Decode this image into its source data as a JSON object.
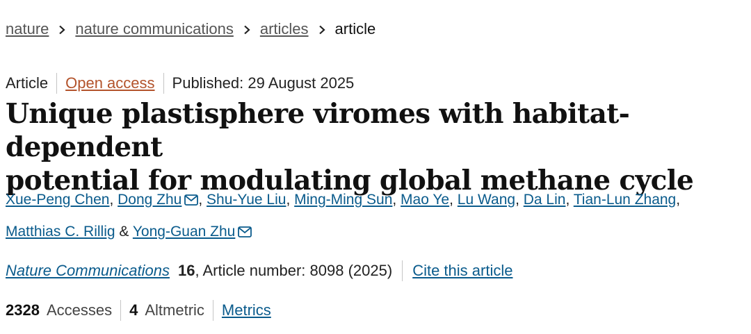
{
  "breadcrumb": {
    "items": [
      {
        "label": "nature",
        "link": true
      },
      {
        "label": "nature communications",
        "link": true
      },
      {
        "label": "articles",
        "link": true
      },
      {
        "label": "article",
        "link": false
      }
    ]
  },
  "article_meta": {
    "type": "Article",
    "access": "Open access",
    "published": "Published: 29 August 2025"
  },
  "title_lines": [
    "Unique plastisphere viromes with habitat-dependent",
    "potential for modulating global methane cycle"
  ],
  "authors": [
    {
      "name": "Xue-Peng Chen",
      "mail": false,
      "sep": ", "
    },
    {
      "name": "Dong Zhu",
      "mail": true,
      "sep": ", "
    },
    {
      "name": "Shu-Yue Liu",
      "mail": false,
      "sep": ", "
    },
    {
      "name": "Ming-Ming Sun",
      "mail": false,
      "sep": ", "
    },
    {
      "name": "Mao Ye",
      "mail": false,
      "sep": ", "
    },
    {
      "name": "Lu Wang",
      "mail": false,
      "sep": ", "
    },
    {
      "name": "Da Lin",
      "mail": false,
      "sep": ", "
    },
    {
      "name": "Tian-Lun Zhang",
      "mail": false,
      "sep": ","
    },
    {
      "name": "Matthias C. Rillig",
      "mail": false,
      "sep": " & "
    },
    {
      "name": "Yong-Guan Zhu",
      "mail": true,
      "sep": ""
    }
  ],
  "citation": {
    "journal": "Nature Communications",
    "volume": "16",
    "article_number": ", Article number: 8098 (2025)",
    "cite_label": "Cite this article"
  },
  "metrics": {
    "accesses_count": "2328",
    "accesses_label": "Accesses",
    "altmetric_count": "4",
    "altmetric_label": "Altmetric",
    "metrics_label": "Metrics"
  },
  "icons": {
    "breadcrumb_separator": "chevron-right-icon",
    "author_contact": "envelope-icon"
  },
  "colors": {
    "link": "#0a5b8c",
    "open_access": "#b3532b",
    "title": "#111111"
  }
}
